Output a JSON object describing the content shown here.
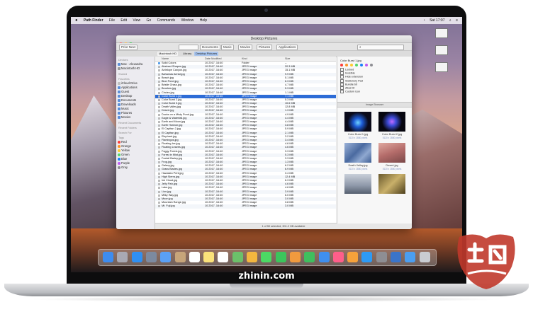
{
  "menubar": {
    "apple": "",
    "app_name": "Path Finder",
    "items": [
      "File",
      "Edit",
      "View",
      "Go",
      "Commands",
      "Window",
      "Help"
    ],
    "time": "Sat 17:07"
  },
  "desktop_icons": [
    ""
  ],
  "window": {
    "title": "Desktop Pictures",
    "toolbar": {
      "back_forward": "Prior  Next",
      "view_modes": "",
      "documents": "Documents",
      "music": "Music",
      "movies": "Movies",
      "pictures": "Pictures",
      "applications": "Applications"
    },
    "path_tabs": [
      "Macintosh HD",
      "Library",
      "Desktop Pictures"
    ],
    "sidebar": {
      "sections": [
        {
          "title": "Devices",
          "items": [
            "Mac - Alexandra",
            "Macintosh HD"
          ]
        },
        {
          "title": "Shared",
          "items": []
        },
        {
          "title": "Favorites",
          "items": [
            "iCloud Drive",
            "Applications",
            "Guest",
            "Desktop",
            "Documents",
            "Downloads",
            "Music",
            "Pictures",
            "Movies"
          ]
        },
        {
          "title": "Recent Documents",
          "items": []
        },
        {
          "title": "Recent Folders",
          "items": []
        },
        {
          "title": "Search For",
          "items": []
        }
      ],
      "tags_title": "Tags",
      "tags": [
        {
          "label": "Red",
          "color": "#fc3d39"
        },
        {
          "label": "Orange",
          "color": "#fd9426"
        },
        {
          "label": "Yellow",
          "color": "#fecb2e"
        },
        {
          "label": "Green",
          "color": "#53d769"
        },
        {
          "label": "Blue",
          "color": "#147efb"
        },
        {
          "label": "Purple",
          "color": "#bf5af2"
        },
        {
          "label": "Gray",
          "color": "#8e8e93"
        }
      ]
    },
    "columns": {
      "name": "Name",
      "date": "Date Modified",
      "kind": "Kind",
      "size": "Size"
    },
    "files": [
      {
        "name": "Solid Colors",
        "date": "10 2017, 16:40",
        "kind": "Folder",
        "size": "--",
        "folder": true
      },
      {
        "name": "Abstract Shapes.jpg",
        "date": "10 2017, 16:40",
        "kind": "JPEG image",
        "size": "20.3 MB"
      },
      {
        "name": "Antelope Canyon.jpg",
        "date": "10 2017, 16:40",
        "kind": "JPEG image",
        "size": "15.1 MB"
      },
      {
        "name": "Bahamas Aerial.jpg",
        "date": "10 2017, 16:40",
        "kind": "JPEG image",
        "size": "9.9 MB"
      },
      {
        "name": "Beach.jpg",
        "date": "10 2017, 16:40",
        "kind": "JPEG image",
        "size": "5.1 MB"
      },
      {
        "name": "Blue Pond.jpg",
        "date": "10 2017, 16:40",
        "kind": "JPEG image",
        "size": "6.3 MB"
      },
      {
        "name": "Bristle Grass.jpg",
        "date": "10 2017, 16:40",
        "kind": "JPEG image",
        "size": "4.7 MB"
      },
      {
        "name": "Brushes.jpg",
        "date": "10 2017, 16:40",
        "kind": "JPEG image",
        "size": "5.3 MB"
      },
      {
        "name": "Circles.jpg",
        "date": "10 2017, 16:40",
        "kind": "JPEG image",
        "size": "1.1 MB"
      },
      {
        "name": "Color Burst 1.jpg",
        "date": "10 2017, 16:40",
        "kind": "JPEG image",
        "size": "7.1 MB",
        "selected": true
      },
      {
        "name": "Color Burst 2.jpg",
        "date": "10 2017, 16:40",
        "kind": "JPEG image",
        "size": "5.3 MB"
      },
      {
        "name": "Color Burst 3.jpg",
        "date": "10 2017, 16:40",
        "kind": "JPEG image",
        "size": "10.6 MB"
      },
      {
        "name": "Death Valley.jpg",
        "date": "10 2017, 16:40",
        "kind": "JPEG image",
        "size": "12.8 MB"
      },
      {
        "name": "Desert.jpg",
        "date": "10 2017, 16:40",
        "kind": "JPEG image",
        "size": "1.3 MB"
      },
      {
        "name": "Ducks on a Misty Pond.jpg",
        "date": "10 2017, 16:40",
        "kind": "JPEG image",
        "size": "4.9 MB"
      },
      {
        "name": "Eagle & Waterfall.jpg",
        "date": "10 2017, 16:40",
        "kind": "JPEG image",
        "size": "4.4 MB"
      },
      {
        "name": "Earth and Moon.jpg",
        "date": "10 2017, 16:40",
        "kind": "JPEG image",
        "size": "4.4 MB"
      },
      {
        "name": "Earth Horizon.jpg",
        "date": "10 2017, 16:40",
        "kind": "JPEG image",
        "size": "3.8 MB"
      },
      {
        "name": "El Capitan 2.jpg",
        "date": "10 2017, 16:40",
        "kind": "JPEG image",
        "size": "5.9 MB"
      },
      {
        "name": "El Capitan.jpg",
        "date": "10 2017, 16:40",
        "kind": "JPEG image",
        "size": "2.1 MB"
      },
      {
        "name": "Elephant.jpg",
        "date": "10 2017, 16:40",
        "kind": "JPEG image",
        "size": "3.2 MB"
      },
      {
        "name": "Flamingos.jpg",
        "date": "10 2017, 16:40",
        "kind": "JPEG image",
        "size": "3.4 MB"
      },
      {
        "name": "Floating Ice.jpg",
        "date": "10 2017, 16:40",
        "kind": "JPEG image",
        "size": "4.6 MB"
      },
      {
        "name": "Floating Leaves.jpg",
        "date": "10 2017, 16:40",
        "kind": "JPEG image",
        "size": "4.6 MB"
      },
      {
        "name": "Foggy Forest.jpg",
        "date": "10 2017, 16:40",
        "kind": "JPEG image",
        "size": "3.3 MB"
      },
      {
        "name": "Forest in Mist.jpg",
        "date": "10 2017, 16:40",
        "kind": "JPEG image",
        "size": "5.3 MB"
      },
      {
        "name": "Foxtail Barley.jpg",
        "date": "10 2017, 16:40",
        "kind": "JPEG image",
        "size": "3.3 MB"
      },
      {
        "name": "Frog.jpg",
        "date": "10 2017, 16:40",
        "kind": "JPEG image",
        "size": "1.3 MB"
      },
      {
        "name": "Galaxy.jpg",
        "date": "10 2017, 16:40",
        "kind": "JPEG image",
        "size": "6.2 MB"
      },
      {
        "name": "Grass Blades.jpg",
        "date": "10 2017, 16:40",
        "kind": "JPEG image",
        "size": "6.9 MB"
      },
      {
        "name": "Hawaiian Print.jpg",
        "date": "10 2017, 16:40",
        "kind": "JPEG image",
        "size": "3.4 MB"
      },
      {
        "name": "High Sierra.jpg",
        "date": "10 2017, 16:40",
        "kind": "JPEG image",
        "size": "12.4 MB"
      },
      {
        "name": "Ink Cloud.jpg",
        "date": "10 2017, 16:40",
        "kind": "JPEG image",
        "size": "6.3 MB"
      },
      {
        "name": "Jelly Fish.jpg",
        "date": "10 2017, 16:40",
        "kind": "JPEG image",
        "size": "4.6 MB"
      },
      {
        "name": "Lake.jpg",
        "date": "10 2017, 16:40",
        "kind": "JPEG image",
        "size": "4.6 MB"
      },
      {
        "name": "Lion.jpg",
        "date": "10 2017, 16:40",
        "kind": "JPEG image",
        "size": "3.9 MB"
      },
      {
        "name": "Milky Way.jpg",
        "date": "10 2017, 16:40",
        "kind": "JPEG image",
        "size": "6.0 MB"
      },
      {
        "name": "Moon.jpg",
        "date": "10 2017, 16:40",
        "kind": "JPEG image",
        "size": "3.0 MB"
      },
      {
        "name": "Mountain Range.jpg",
        "date": "10 2017, 16:40",
        "kind": "JPEG image",
        "size": "3.8 MB"
      },
      {
        "name": "Mt. Fuji.jpg",
        "date": "10 2017, 16:40",
        "kind": "JPEG image",
        "size": "3.0 MB"
      }
    ],
    "status": "1 of 50 selected, 301.2 GB available",
    "tag_panel": {
      "file_title": "Color Burst 1.jpg",
      "swatches": [
        "#fc3d39",
        "#fd9426",
        "#fecb2e",
        "#53d769",
        "#147efb",
        "#bf5af2",
        "#8e8e93"
      ],
      "options": [
        "Locked",
        "Invisible",
        "Hide extension",
        "Stationery Pad",
        "Bundle bit",
        "Alias bit",
        "Custom icon"
      ]
    },
    "image_browser": {
      "title": "Image Browser",
      "items": [
        {
          "label": "Color Burst 1.jpg",
          "sub": "5120 x 2880 pixels"
        },
        {
          "label": "Color Burst 2.jpg",
          "sub": "5120 x 2880 pixels"
        },
        {
          "label": "Death Valley.jpg",
          "sub": "5120 x 2880 pixels"
        },
        {
          "label": "Desert.jpg",
          "sub": "5120 x 2880 pixels"
        },
        {
          "label": "",
          "sub": ""
        },
        {
          "label": "",
          "sub": ""
        }
      ]
    }
  },
  "dock_icons": [
    "finder-icon",
    "launchpad-icon",
    "safari-icon",
    "rocket-icon",
    "mail-icon",
    "contacts-icon",
    "calendar-icon",
    "notes-icon",
    "reminders-icon",
    "maps-icon",
    "photos-icon",
    "messages-icon",
    "facetime-icon",
    "pages-icon",
    "numbers-icon",
    "keynote-icon",
    "itunes-icon",
    "ibooks-icon",
    "appstore-icon",
    "preferences-icon",
    "path-finder-icon",
    "downloads-icon",
    "trash-icon"
  ],
  "overlay_text": "zhinin.com"
}
